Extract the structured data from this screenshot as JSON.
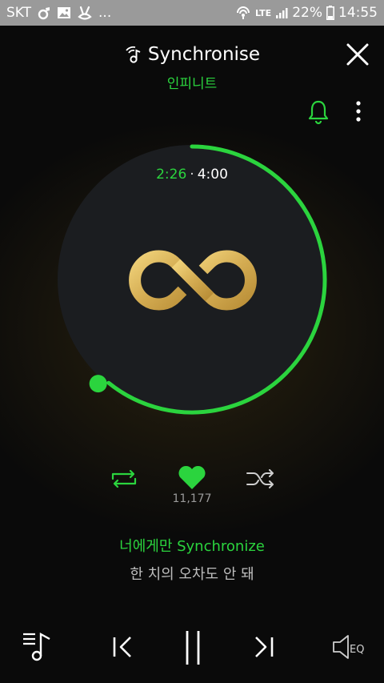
{
  "status_bar": {
    "carrier": "SKT",
    "ellipsis": "...",
    "network": "LTE",
    "battery": "22%",
    "time": "14:55"
  },
  "header": {
    "title": "Synchronise",
    "subtitle": "인피니트"
  },
  "player": {
    "current_time": "2:26",
    "separator": "·",
    "total_time": "4:00",
    "progress_fraction": 0.608,
    "likes": "11,177",
    "lyric_current": "너에게만 Synchronize",
    "lyric_next": "한 치의 오차도 안 돼"
  },
  "bottom_bar": {
    "eq_label": "EQ"
  },
  "colors": {
    "accent_green": "#2bd43e",
    "logo_gold": "#d9b45a",
    "status_bar_bg": "#9a9a9a"
  },
  "icons": {
    "header": "wifi-music-icon",
    "close": "close-icon",
    "alarm": "bell-icon",
    "menu": "more-vertical-icon",
    "repeat": "repeat-icon",
    "like": "heart-icon",
    "shuffle": "shuffle-icon",
    "playlist": "playlist-icon",
    "previous": "previous-icon",
    "pause": "pause-icon",
    "next": "next-icon",
    "equalizer": "speaker-eq-icon"
  }
}
